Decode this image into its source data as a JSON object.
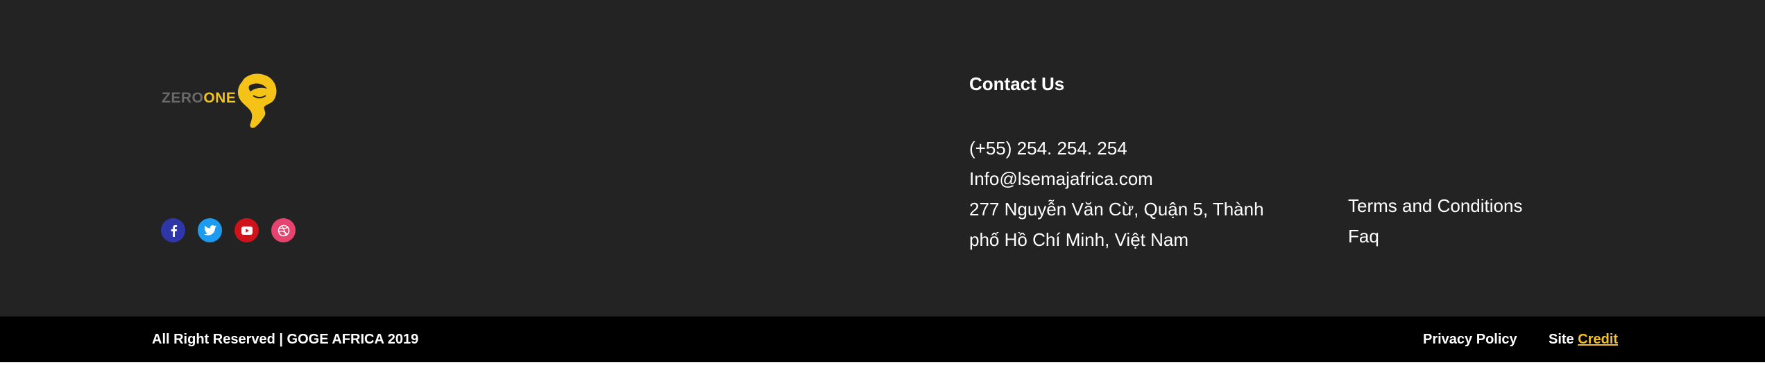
{
  "brand": {
    "logo_part1": "ZERO",
    "logo_part2": "ONE",
    "accent_color": "#f5c218",
    "logo_icon": "africa-head-icon"
  },
  "socials": [
    {
      "name": "facebook-icon",
      "color": "#2f36a8"
    },
    {
      "name": "twitter-icon",
      "color": "#1d9bf0"
    },
    {
      "name": "youtube-icon",
      "color": "#d0121b"
    },
    {
      "name": "dribbble-icon",
      "color": "#e6446f"
    }
  ],
  "contact": {
    "title": "Contact Us",
    "phone": "(+55) 254. 254. 254",
    "email": "Info@lsemajafrica.com",
    "address_line1": "277 Nguyễn Văn Cừ, Quận 5, Thành",
    "address_line2": "phố Hồ Chí Minh, Việt Nam"
  },
  "links": {
    "terms": "Terms and Conditions",
    "faq": "Faq"
  },
  "bottom": {
    "copyright": "All Right Reserved | GOGE AFRICA 2019",
    "privacy": "Privacy Policy",
    "site_label": "Site",
    "credit": "Credit"
  }
}
